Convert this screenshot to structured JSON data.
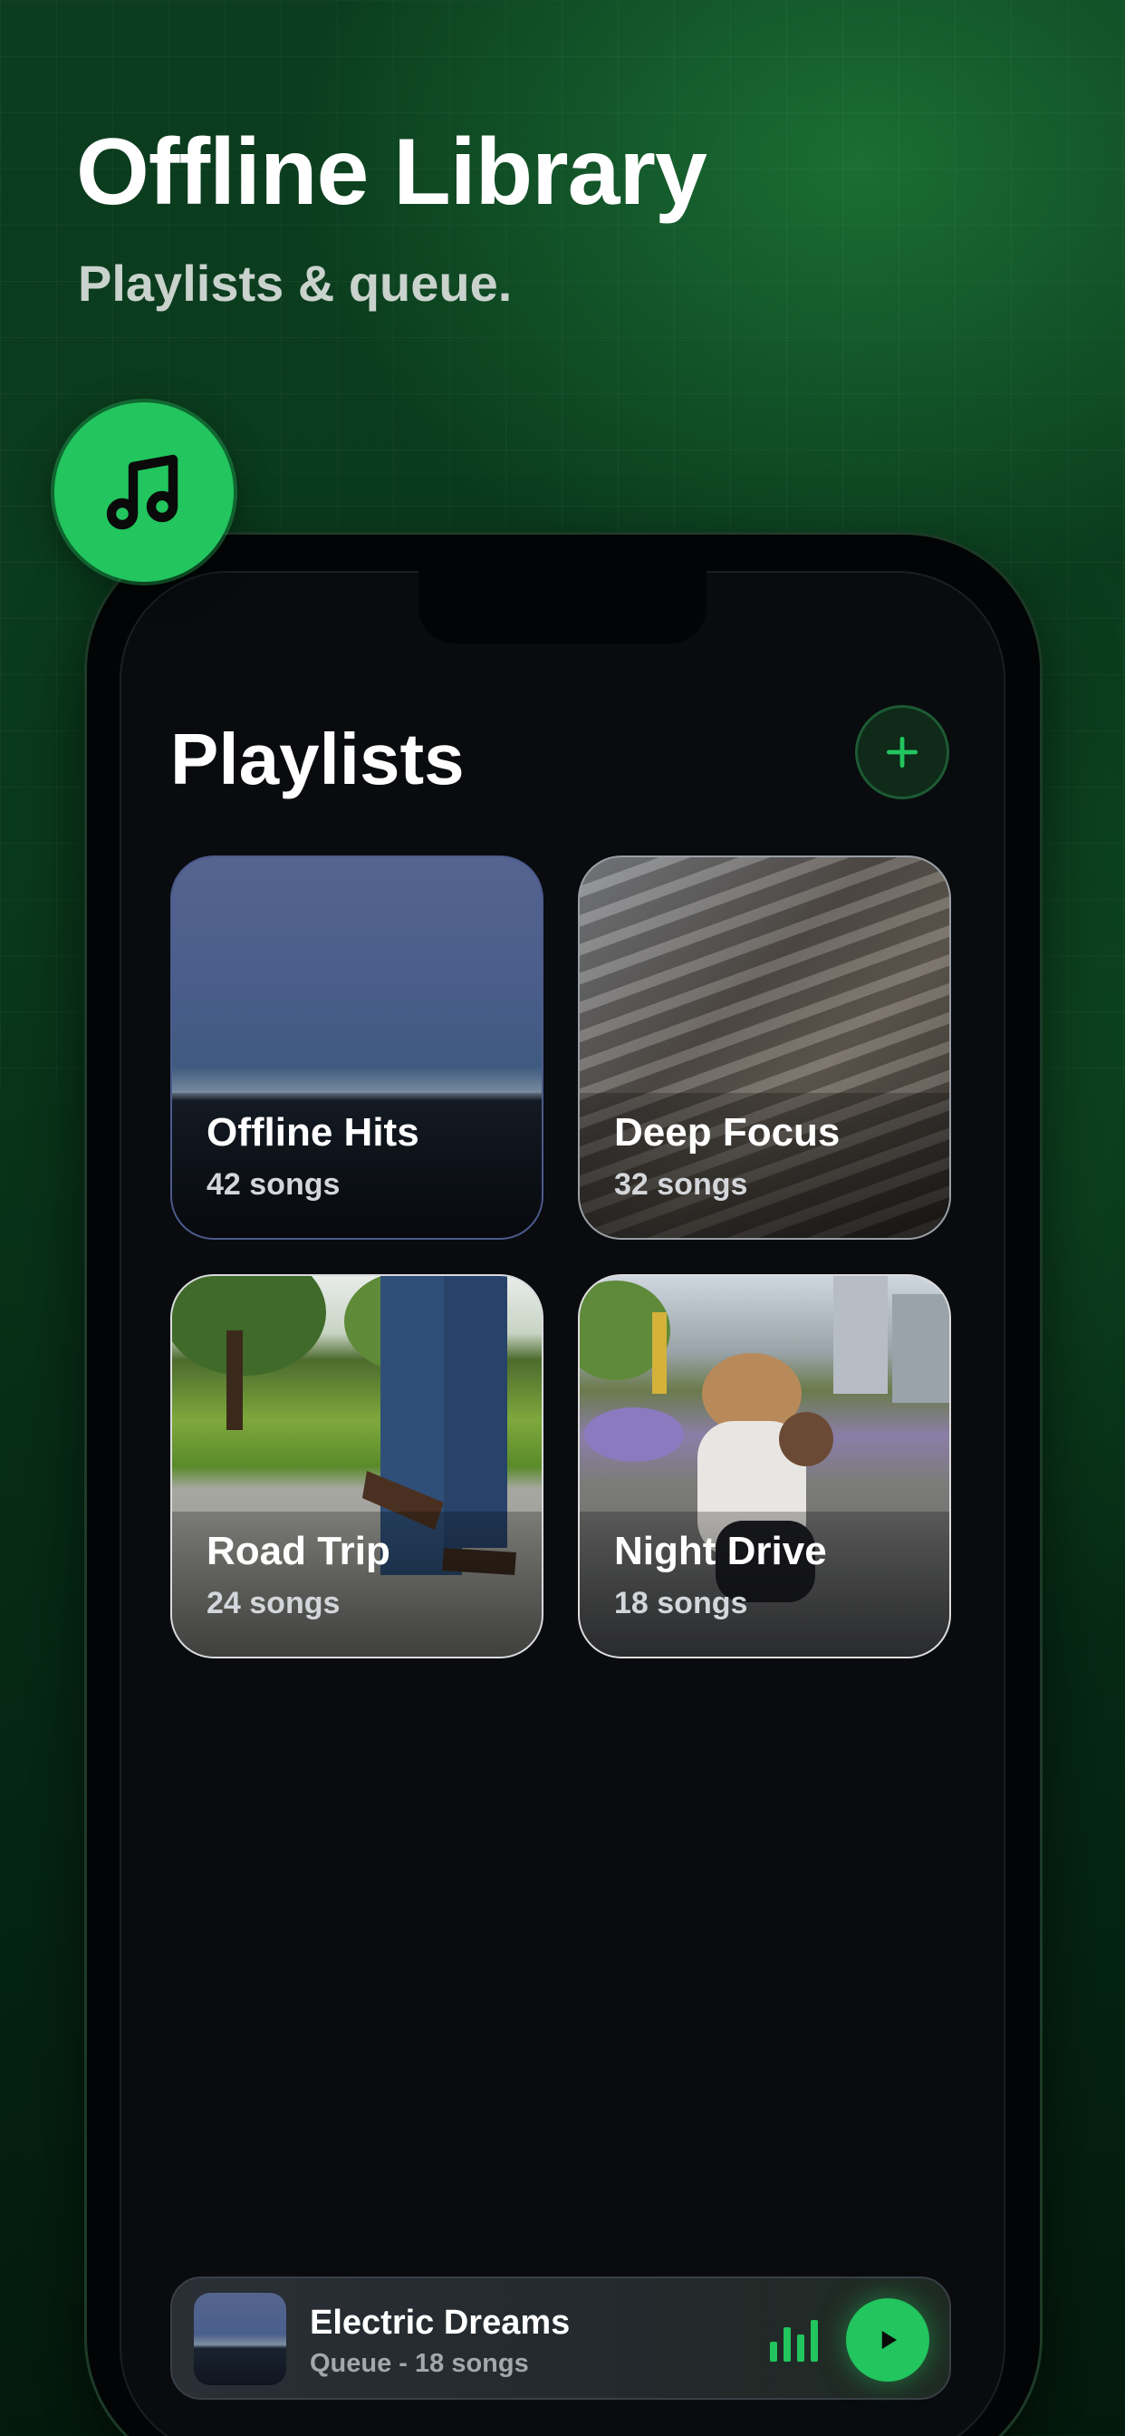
{
  "header": {
    "title": "Offline Library",
    "subtitle": "Playlists & queue."
  },
  "badge": {
    "icon": "music-note-icon"
  },
  "screen": {
    "title": "Playlists",
    "add_button": {
      "icon": "plus-icon"
    },
    "playlists": [
      {
        "name": "Offline Hits",
        "count": "42 songs"
      },
      {
        "name": "Deep Focus",
        "count": "32 songs"
      },
      {
        "name": "Road Trip",
        "count": "24 songs"
      },
      {
        "name": "Night Drive",
        "count": "18 songs"
      }
    ],
    "mini_player": {
      "title": "Electric Dreams",
      "subtitle": "Queue - 18 songs",
      "equalizer_icon": "equalizer-icon",
      "play_icon": "play-icon"
    }
  },
  "colors": {
    "accent": "#22c55e",
    "background": "#0a3a1c",
    "screen": "#090b0e"
  }
}
